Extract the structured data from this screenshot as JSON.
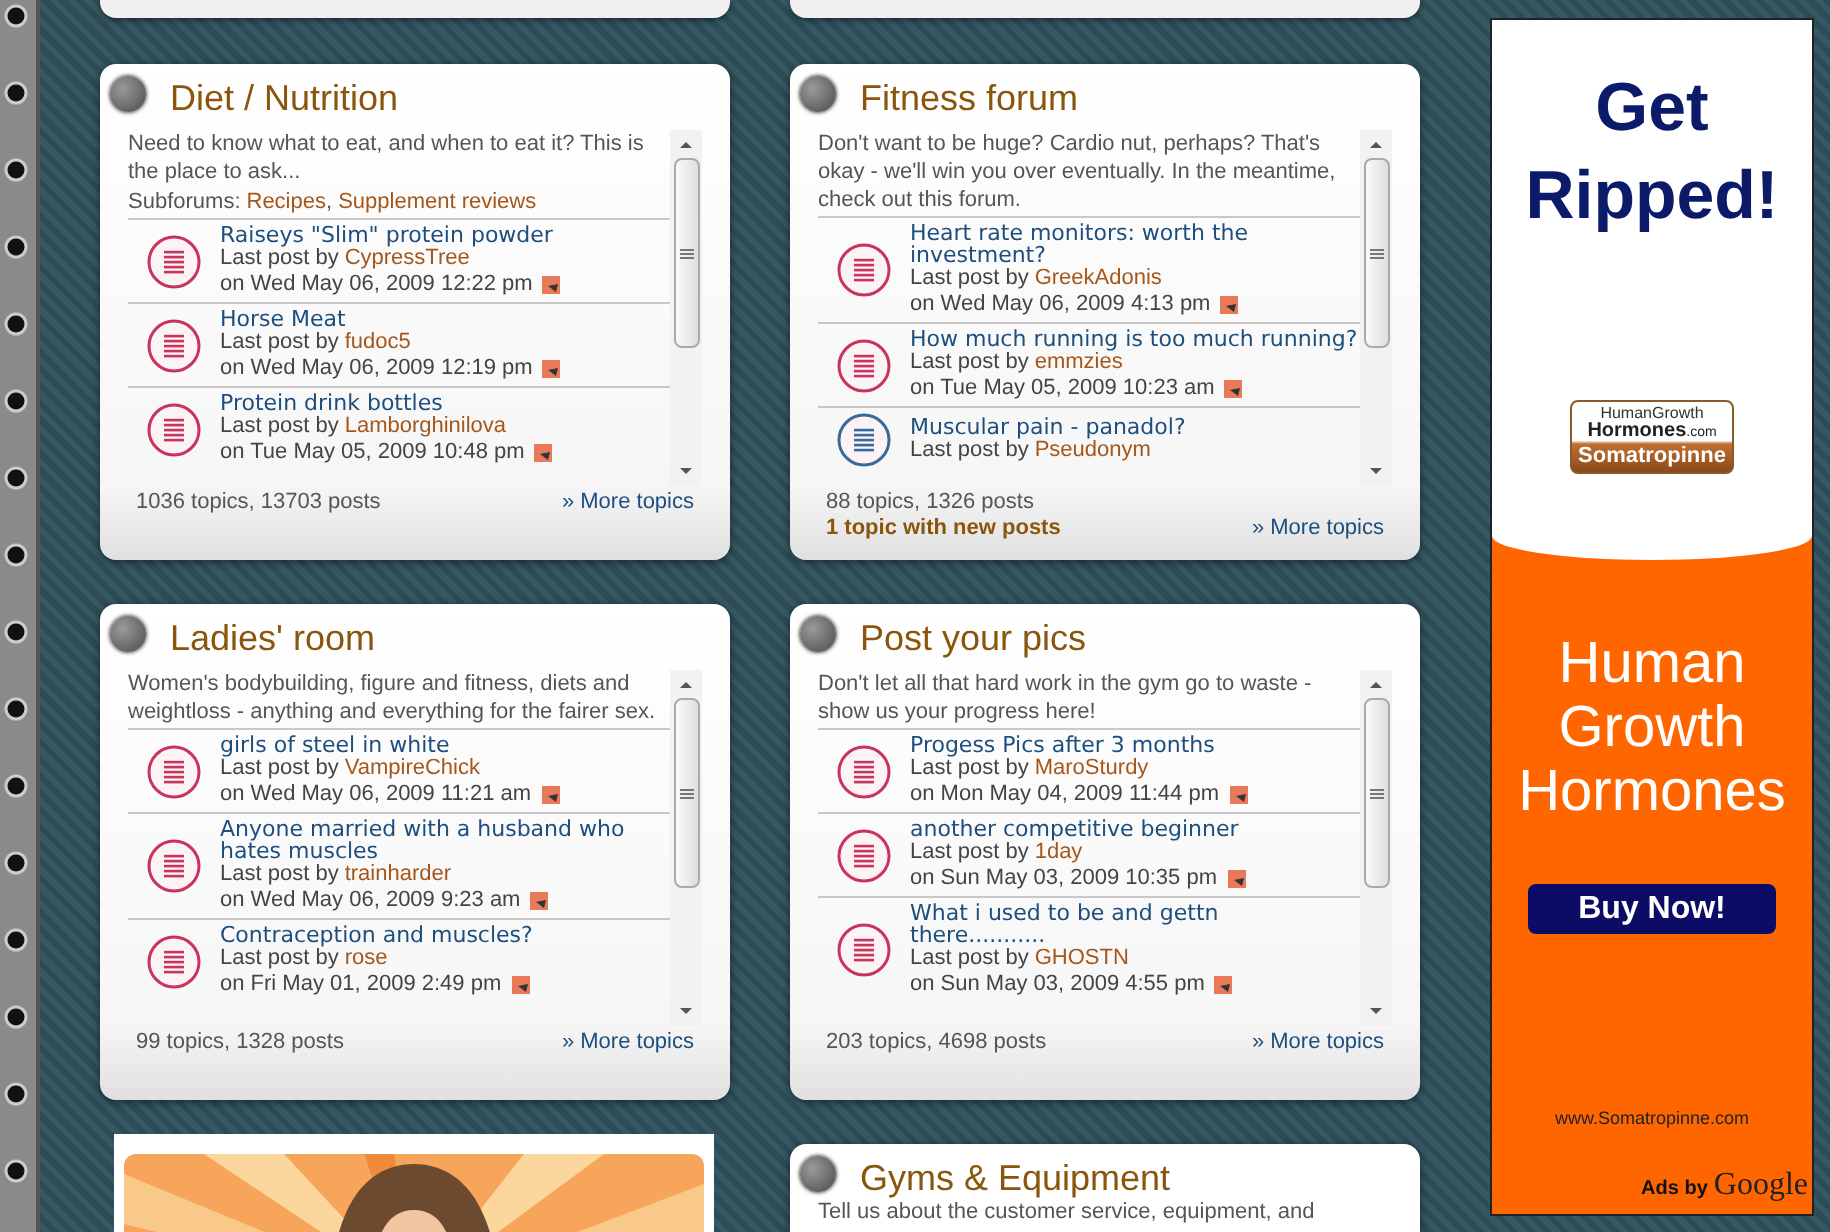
{
  "forums": [
    {
      "title": "Diet / Nutrition",
      "description": "Need to know what to eat, and when to eat it? This is the place to ask...",
      "subforums_label": "Subforums:",
      "subforums": [
        "Recipes",
        "Supplement reviews"
      ],
      "subforum_separator": ",",
      "topics": [
        {
          "title": "Raiseys \"Slim\" protein powder",
          "by": "Last post by",
          "author": "CypressTree",
          "date": "on Wed May 06, 2009 12:22 pm",
          "unread": true
        },
        {
          "title": "Horse Meat",
          "by": "Last post by",
          "author": "fudoc5",
          "date": "on Wed May 06, 2009 12:19 pm",
          "unread": true
        },
        {
          "title": "Protein drink bottles",
          "by": "Last post by",
          "author": "Lamborghinilova",
          "date": "on Tue May 05, 2009 10:48 pm",
          "unread": true
        }
      ],
      "stats": "1036 topics, 13703 posts",
      "more": "» More topics"
    },
    {
      "title": "Fitness forum",
      "description": "Don't want to be huge? Cardio nut, perhaps? That's okay - we'll win you over eventually. In the meantime, check out this forum.",
      "topics": [
        {
          "title": "Heart rate monitors: worth the investment?",
          "by": "Last post by",
          "author": "GreekAdonis",
          "date": "on Wed May 06, 2009 4:13 pm",
          "unread": true
        },
        {
          "title": "How much running is too much running?",
          "by": "Last post by",
          "author": "emmzies",
          "date": "on Tue May 05, 2009 10:23 am",
          "unread": true
        },
        {
          "title": "Muscular pain - panadol?",
          "by": "Last post by",
          "author": "Pseudonym",
          "unread": false
        }
      ],
      "stats": "88 topics, 1326 posts",
      "new_posts": "1 topic with new posts",
      "more": "» More topics"
    },
    {
      "title": "Ladies' room",
      "description": "Women's bodybuilding, figure and fitness, diets and weightloss - anything and everything for the fairer sex.",
      "topics": [
        {
          "title": "girls of steel in white",
          "by": "Last post by",
          "author": "VampireChick",
          "date": "on Wed May 06, 2009 11:21 am",
          "unread": true
        },
        {
          "title": "Anyone married with a husband who hates muscles",
          "by": "Last post by",
          "author": "trainharder",
          "date": "on Wed May 06, 2009 9:23 am",
          "unread": true
        },
        {
          "title": "Contraception and muscles?",
          "by": "Last post by",
          "author": "rose",
          "date": "on Fri May 01, 2009 2:49 pm",
          "unread": true
        }
      ],
      "stats": "99 topics, 1328 posts",
      "more": "» More topics"
    },
    {
      "title": "Post your pics",
      "description": "Don't let all that hard work in the gym go to waste - show us your progress here!",
      "topics": [
        {
          "title": "Progess Pics after 3 months",
          "by": "Last post by",
          "author": "MaroSturdy",
          "date": "on Mon May 04, 2009 11:44 pm",
          "unread": true
        },
        {
          "title": "another competitive beginner",
          "by": "Last post by",
          "author": "1day",
          "date": "on Sun May 03, 2009 10:35 pm",
          "unread": true
        },
        {
          "title": "What i used to be and gettn there...........",
          "by": "Last post by",
          "author": "GHOSTN",
          "date": "on Sun May 03, 2009 4:55 pm",
          "unread": true
        }
      ],
      "stats": "203 topics, 4698 posts",
      "more": "» More topics"
    }
  ],
  "bottom_forum": {
    "title": "Gyms & Equipment",
    "description": "Tell us about the customer service, equipment, and"
  },
  "ad": {
    "headline": "Get Ripped!",
    "logo_top": "HumanGrowth",
    "logo_main": "Hormones",
    "logo_com": ".com",
    "logo_bottom": "Somatropinne",
    "tagline": "Human Growth Hormones",
    "button": "Buy Now!",
    "url": "www.Somatropinne.com",
    "ads_by": "Ads by",
    "brand": "Google"
  }
}
